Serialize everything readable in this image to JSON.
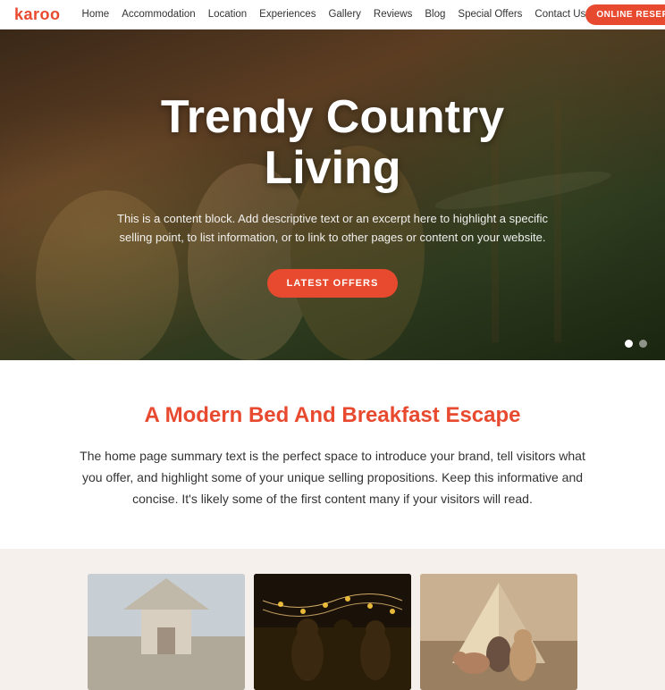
{
  "nav": {
    "logo": "karoo",
    "links": [
      {
        "label": "Home",
        "name": "home"
      },
      {
        "label": "Accommodation",
        "name": "accommodation"
      },
      {
        "label": "Location",
        "name": "location"
      },
      {
        "label": "Experiences",
        "name": "experiences"
      },
      {
        "label": "Gallery",
        "name": "gallery"
      },
      {
        "label": "Reviews",
        "name": "reviews"
      },
      {
        "label": "Blog",
        "name": "blog"
      },
      {
        "label": "Special Offers",
        "name": "special-offers"
      },
      {
        "label": "Contact Us",
        "name": "contact-us"
      }
    ],
    "cta_label": "ONLINE RESERVATIONS"
  },
  "hero": {
    "title": "Trendy Country Living",
    "subtitle": "This is a content block. Add descriptive text or an excerpt here to highlight a specific selling point, to list information, or to link to other pages or content on your website.",
    "btn_label": "LATEST OFFERS",
    "dot1_active": true,
    "dot2_active": false
  },
  "intro": {
    "heading": "A Modern Bed And Breakfast Escape",
    "text": "The home page summary text is the perfect space to introduce your brand, tell visitors what you offer, and highlight some of your unique selling propositions. Keep this informative and concise. It's likely some of the first content many if your visitors will read."
  },
  "gallery": {
    "items": [
      {
        "alt": "Accommodation exterior"
      },
      {
        "alt": "Outdoor string lights gathering"
      },
      {
        "alt": "Tent glamping with guests"
      }
    ]
  },
  "colors": {
    "accent": "#e84a2f",
    "background_alt": "#f5f0eb"
  }
}
